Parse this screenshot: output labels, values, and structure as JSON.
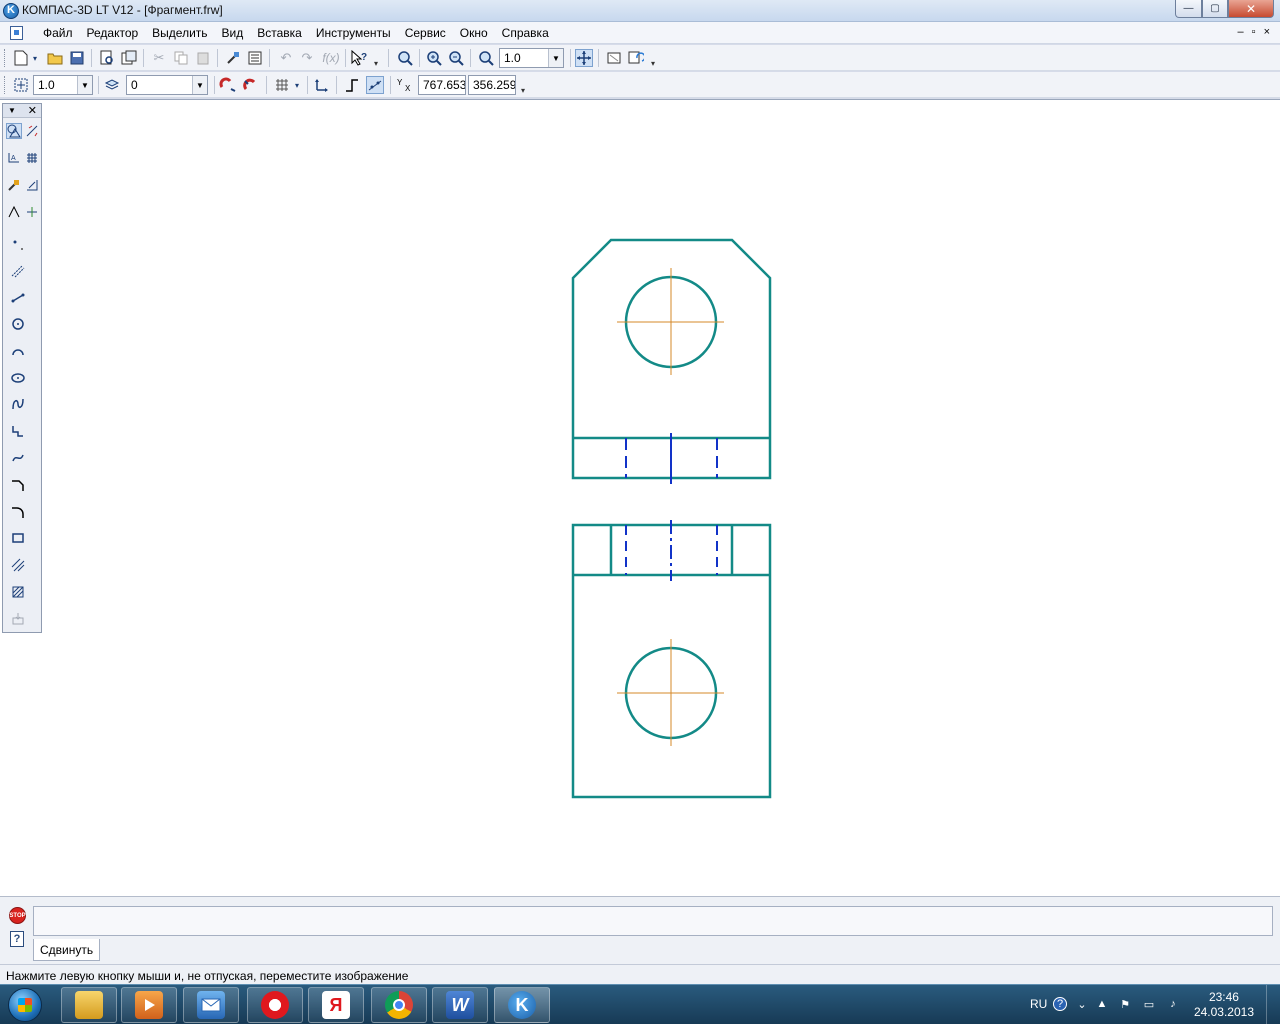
{
  "window": {
    "title": "КОМПАС-3D LT V12 - [Фрагмент.frw]",
    "min_glyph": "—",
    "max_glyph": "▢",
    "close_glyph": "✕"
  },
  "menu": {
    "items": [
      "Файл",
      "Редактор",
      "Выделить",
      "Вид",
      "Вставка",
      "Инструменты",
      "Сервис",
      "Окно",
      "Справка"
    ],
    "mdi_min": "–",
    "mdi_restore": "▫",
    "mdi_close": "×"
  },
  "toolbar1": {
    "zoom_value": "1.0"
  },
  "toolbar2": {
    "step_value": "1.0",
    "layer_value": "0",
    "coord_x": "767.653",
    "coord_y": "356.259"
  },
  "command_panel": {
    "tab_label": "Сдвинуть",
    "stop_label": "STOP",
    "help_label": "?"
  },
  "status": {
    "text": "Нажмите левую кнопку мыши и, не отпуская, переместите изображение"
  },
  "taskbar": {
    "apps": [
      "explorer-icon",
      "media-player-icon",
      "mail-icon",
      "opera-icon",
      "yandex-icon",
      "chrome-icon",
      "word-icon",
      "kompas-icon"
    ],
    "yandex_letter": "Я",
    "word_letter": "W",
    "kompas_letter": "K",
    "lang": "RU",
    "time": "23:46",
    "date": "24.03.2013"
  },
  "drawing": {
    "outline_color": "#138a87",
    "axis_color": "#d4892a",
    "hidden_color": "#1233c8"
  }
}
